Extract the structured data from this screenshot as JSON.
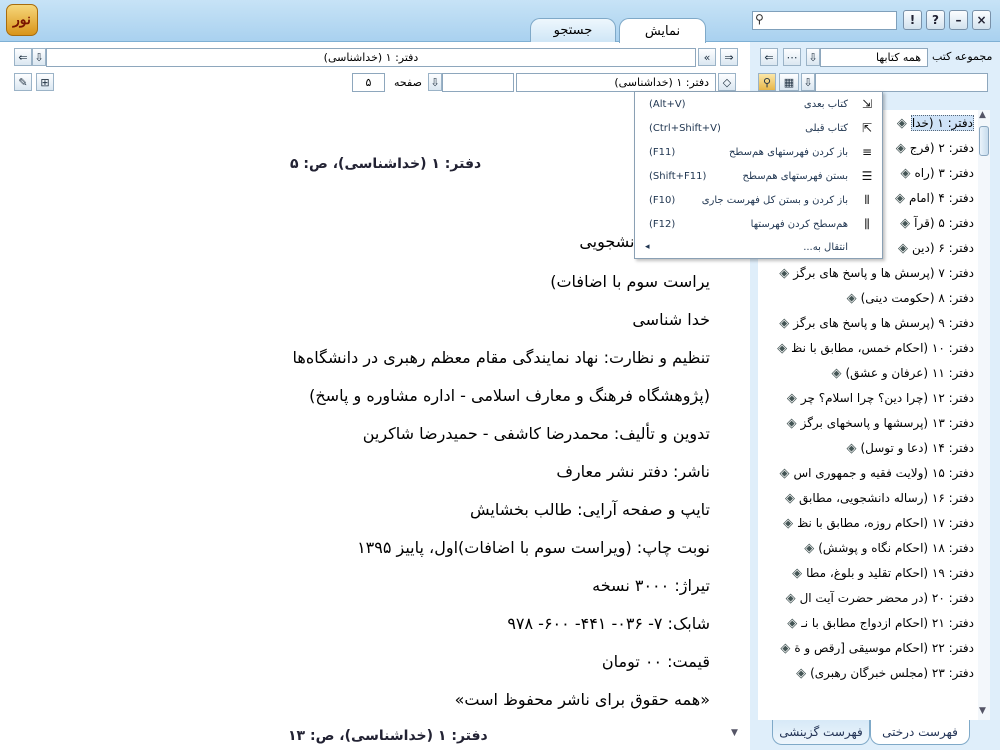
{
  "tabs": {
    "display": "نمایش",
    "search": "جستجو"
  },
  "winbuttons": {
    "info": "!",
    "help": "?",
    "minimize": "–",
    "close": "×"
  },
  "nav": {
    "location_value": "دفتر: ۱ (خداشناسی)",
    "section_value": "دفتر: ۱ (خداشناسی)",
    "page_label": "صفحه",
    "page_value": "۵"
  },
  "document": {
    "header_top": "دفتر: ۱ (خداشناسی)، ص: ۵",
    "header_bottom": "دفتر: ۱ (خداشناسی)، ص: ۱۳",
    "partial_line": "ه]",
    "lines": [
      "پاسخ‌های دانشجویی",
      "یراست سوم با اضافات)",
      "خدا شناسی",
      "تنظیم و نظارت: نهاد نمایندگی مقام معظم رهبری در دانشگاه‌ها",
      "(پژوهشگاه فرهنگ و معارف اسلامی - اداره مشاوره و پاسخ)",
      "تدوین و تألیف: محمدرضا کاشفی - حمیدرضا شاکرین",
      "ناشر: دفتر نشر معارف",
      "تایپ و صفحه آرایی: طالب بخشایش",
      "نوبت چاپ: (ویراست سوم با اضافات)اول، پاییز ۱۳۹۵",
      "تیراژ: ۳۰۰۰ نسخه",
      "شابک: ۷- ۰۳۶- ۴۴۱- ۶۰۰- ۹۷۸",
      "قیمت: ۰۰ تومان",
      "«همه حقوق برای ناشر محفوظ است»"
    ]
  },
  "context_menu": {
    "items": [
      {
        "label": "کتاب بعدی",
        "shortcut": "(Alt+V)",
        "icon": "next-book-icon"
      },
      {
        "label": "کتاب قبلی",
        "shortcut": "(Ctrl+Shift+V)",
        "icon": "prev-book-icon"
      },
      {
        "label": "باز کردن فهرستهای هم‌سطح",
        "shortcut": "(F11)",
        "icon": "expand-level-icon"
      },
      {
        "label": "بستن فهرستهای هم‌سطح",
        "shortcut": "(Shift+F11)",
        "icon": "collapse-level-icon"
      },
      {
        "label": "باز کردن و بستن کل فهرست جاری",
        "shortcut": "(F10)",
        "icon": "toggle-all-icon"
      },
      {
        "label": "هم‌سطح کردن فهرستها",
        "shortcut": "(F12)",
        "icon": "level-align-icon"
      },
      {
        "label": "انتقال به...",
        "shortcut": "",
        "icon": ""
      }
    ]
  },
  "right_panel": {
    "collection_label": "مجموعه کتب",
    "collection_value": "همه کتابها",
    "tree_items": [
      "دفتر: ۱ (خدا",
      "دفتر: ۲ (فرج",
      "دفتر: ۳ (راه",
      "دفتر: ۴ (امام",
      "دفتر: ۵ (قرآ",
      "دفتر: ۶ (دین",
      "دفتر: ۷ (پرسش ها و پاسخ های برگز",
      "دفتر: ۸ (حکومت دینی)",
      "دفتر: ۹ (پرسش ها و پاسخ های برگز",
      "دفتر: ۱۰ (احکام خمس، مطابق با نظ",
      "دفتر: ۱۱ (عرفان و عشق)",
      "دفتر: ۱۲ (چرا دین؟ چرا اسلام؟ چر",
      "دفتر: ۱۳ (پرسشها و پاسخهای برگز",
      "دفتر: ۱۴ (دعا و توسل)",
      "دفتر: ۱۵ (ولایت فقیه و جمهوری اس",
      "دفتر: ۱۶ (رساله دانشجویی، مطابق",
      "دفتر: ۱۷ (احکام روزه، مطابق با نظ",
      "دفتر: ۱۸ (احکام نگاه و پوشش)",
      "دفتر: ۱۹ (احکام تقلید و بلوغ، مطا",
      "دفتر: ۲۰ (در محضر حضرت آیت ال",
      "دفتر: ۲۱ (احکام ازدواج مطابق با نـ",
      "دفتر: ۲۲ (احکام موسیقی [رقص و ة",
      "دفتر: ۲۳ (مجلس خبرگان رهبری)"
    ],
    "bottom_tabs": {
      "tree": "فهرست درختی",
      "selected": "فهرست گزینشی"
    }
  }
}
